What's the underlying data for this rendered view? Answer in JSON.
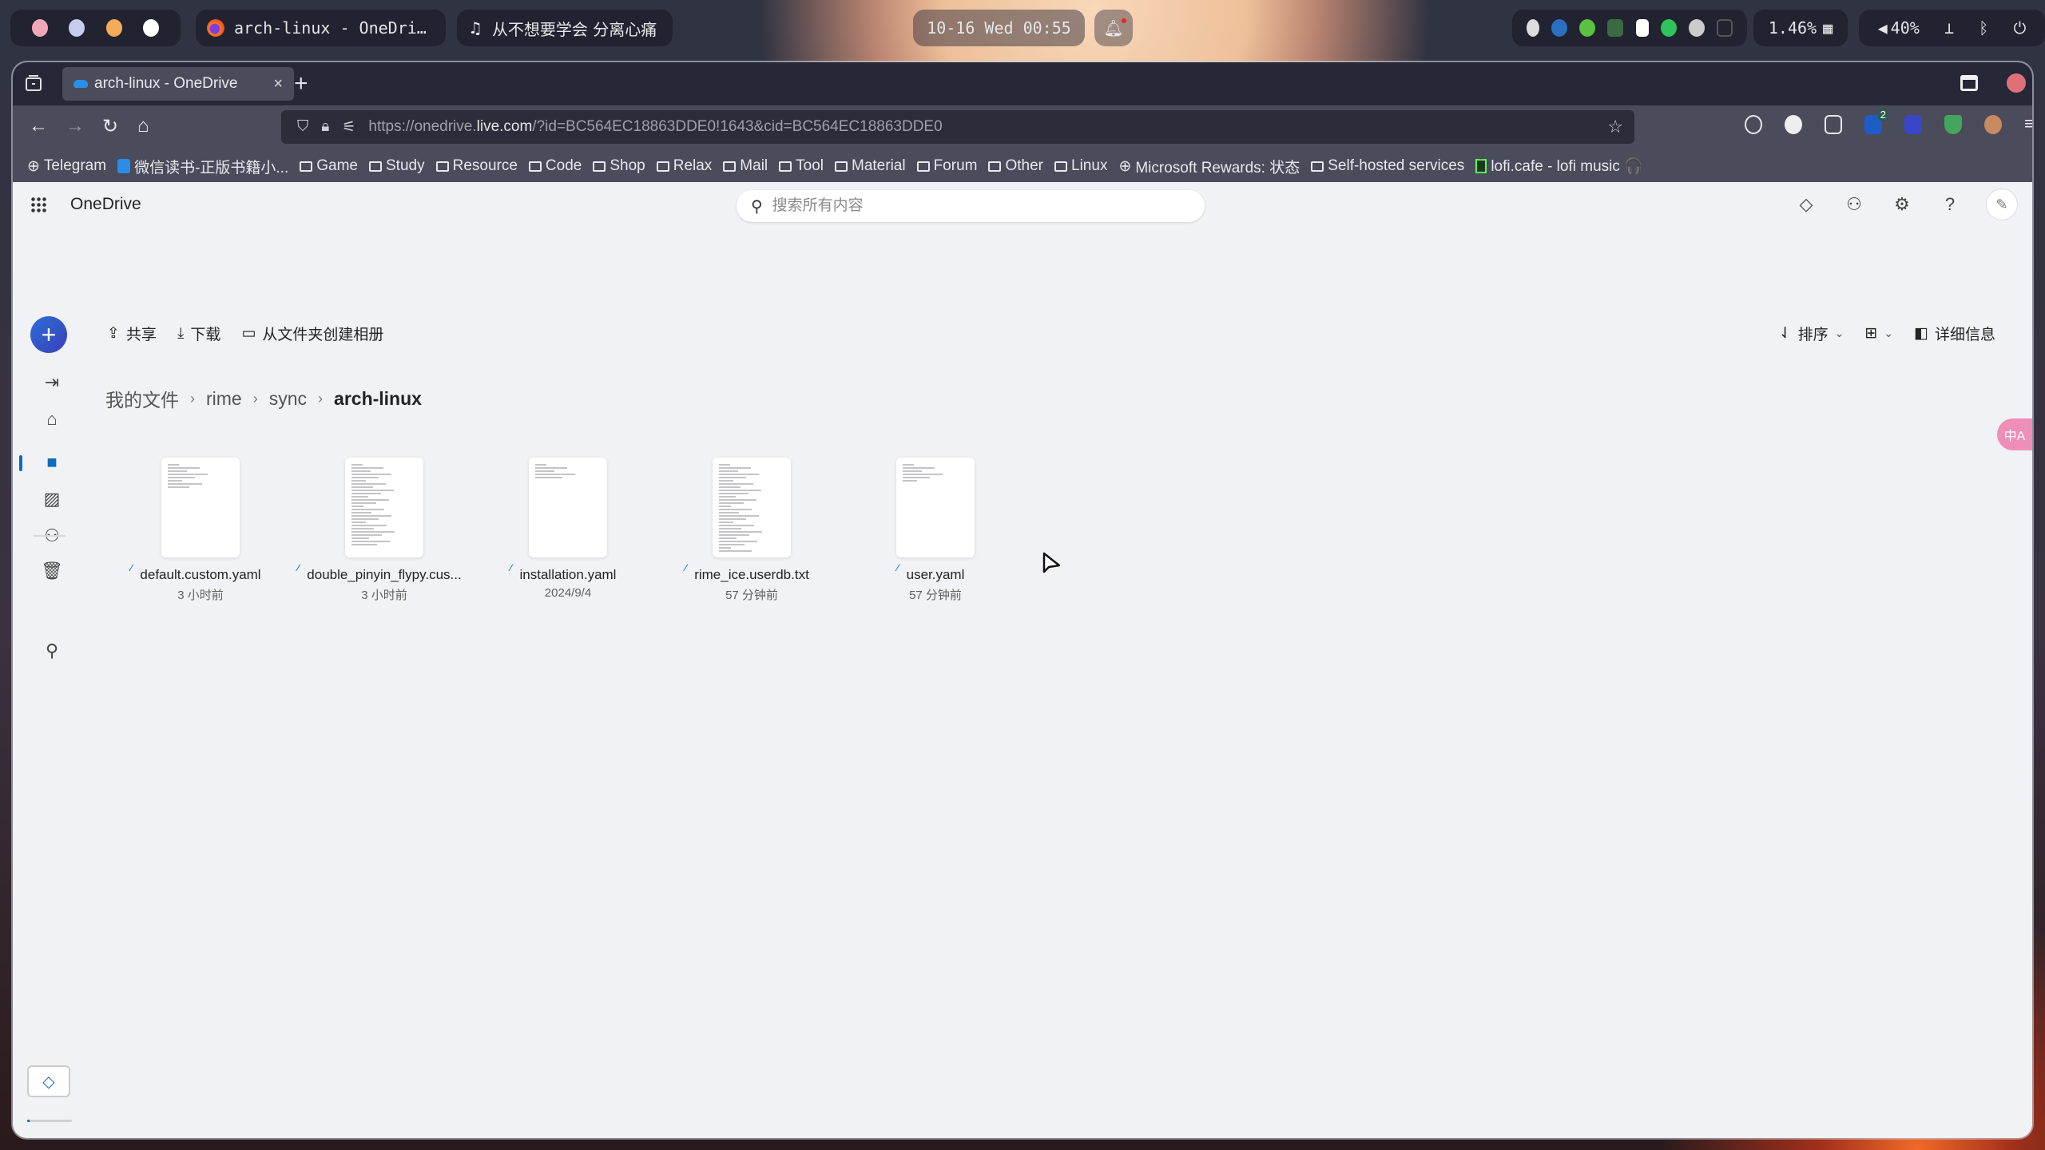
{
  "system_bar": {
    "workspace_dots": [
      "#f4a7b9",
      "#c8cdf0",
      "#f4ab5a",
      "#ffffff"
    ],
    "active_window": {
      "icon": "firefox-icon",
      "title": "arch-linux - OneDri…"
    },
    "music": {
      "icon": "music-note-icon",
      "title": "从不想要学会 分离心痛"
    },
    "clock": "10-16 Wed 00:55",
    "notification_icon": "bell-icon",
    "tray_icons": [
      "bluetooth-icon",
      "blue-app-icon",
      "green-cat-icon",
      "translate-app-icon",
      "play-icon",
      "wechat-icon",
      "steam-icon",
      "input-method-icon"
    ],
    "cpu": "1.46%",
    "volume": "40%",
    "status_icons": [
      "network-icon",
      "bluetooth-icon",
      "power-icon"
    ]
  },
  "browser": {
    "tab": {
      "title": "arch-linux - OneDrive",
      "close": "×"
    },
    "new_tab": "+",
    "url": {
      "prefix": "https://onedrive.",
      "domain": "live.com",
      "suffix": "/?id=BC564EC18863DDE0!1643&cid=BC564EC18863DDE0"
    },
    "extensions": [
      "history-icon",
      "profile-extension-icon",
      "extensions-icon",
      "bitwarden-icon",
      "blue-extension-icon",
      "adguard-icon",
      "owl-extension-icon",
      "menu-icon"
    ],
    "extension_badge": "2",
    "bookmarks": [
      {
        "label": "Telegram",
        "icon": "globe-icon"
      },
      {
        "label": "微信读书-正版书籍小...",
        "icon": "weread-icon"
      },
      {
        "label": "Game",
        "icon": "folder-icon"
      },
      {
        "label": "Study",
        "icon": "folder-icon"
      },
      {
        "label": "Resource",
        "icon": "folder-icon"
      },
      {
        "label": "Code",
        "icon": "folder-icon"
      },
      {
        "label": "Shop",
        "icon": "folder-icon"
      },
      {
        "label": "Relax",
        "icon": "folder-icon"
      },
      {
        "label": "Mail",
        "icon": "folder-icon"
      },
      {
        "label": "Tool",
        "icon": "folder-icon"
      },
      {
        "label": "Material",
        "icon": "folder-icon"
      },
      {
        "label": "Forum",
        "icon": "folder-icon"
      },
      {
        "label": "Other",
        "icon": "folder-icon"
      },
      {
        "label": "Linux",
        "icon": "folder-icon"
      },
      {
        "label": "Microsoft Rewards: 状态",
        "icon": "globe-icon"
      },
      {
        "label": "Self-hosted services",
        "icon": "folder-icon"
      },
      {
        "label": "lofi.cafe - lofi music 🎧",
        "icon": "lofi-icon"
      }
    ]
  },
  "onedrive": {
    "brand": "OneDrive",
    "search_placeholder": "搜索所有内容",
    "header_icons": [
      "premium-diamond-icon",
      "feedback-icon",
      "settings-icon",
      "help-icon"
    ],
    "commands": {
      "share": "共享",
      "download": "下载",
      "create_album": "从文件夹创建相册"
    },
    "view_controls": {
      "sort": "排序",
      "details": "详细信息"
    },
    "breadcrumb": [
      "我的文件",
      "rime",
      "sync",
      "arch-linux"
    ],
    "files": [
      {
        "name": "default.custom.yaml",
        "modified": "3 小时前",
        "lines": 8
      },
      {
        "name": "double_pinyin_flypy.cus...",
        "modified": "3 小时前",
        "lines": 26
      },
      {
        "name": "installation.yaml",
        "modified": "2024/9/4",
        "lines": 5
      },
      {
        "name": "rime_ice.userdb.txt",
        "modified": "57 分钟前",
        "lines": 28
      },
      {
        "name": "user.yaml",
        "modified": "57 分钟前",
        "lines": 6
      }
    ],
    "storage_used_fraction": 0.05,
    "translate_button": "中A",
    "accent_color": "#0f6cbd"
  }
}
